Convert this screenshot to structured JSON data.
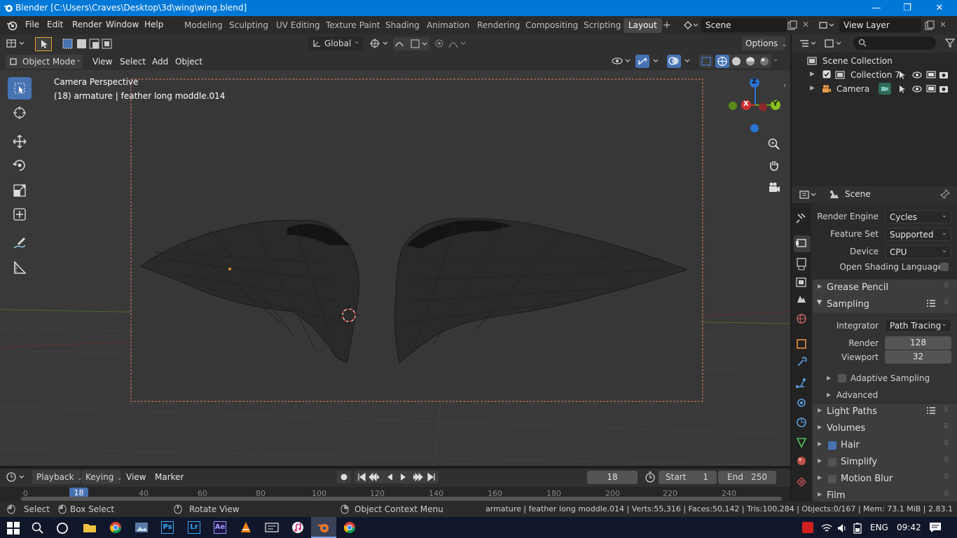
{
  "window": {
    "title": "Blender [C:\\Users\\Craves\\Desktop\\3d\\wing\\wing.blend]",
    "controls": {
      "minimize": "—",
      "maximize": "❐",
      "close": "✕"
    }
  },
  "menu": {
    "file": "File",
    "edit": "Edit",
    "render": "Render",
    "window": "Window",
    "help": "Help"
  },
  "workspaces": [
    "Modeling",
    "Sculpting",
    "UV Editing",
    "Texture Paint",
    "Shading",
    "Animation",
    "Rendering",
    "Compositing",
    "Scripting",
    "Layout"
  ],
  "active_workspace": "Layout",
  "scene_field": "Scene",
  "view_layer_field": "View Layer",
  "toolbar": {
    "orientation": "Global",
    "options": "Options"
  },
  "viewport_header": {
    "mode": "Object Mode",
    "view": "View",
    "select": "Select",
    "add": "Add",
    "object": "Object"
  },
  "viewport": {
    "camera_label": "Camera Perspective",
    "object_label": "(18) armature | feather long moddle.014",
    "gizmo": {
      "z": "Z",
      "x": "X",
      "y": "Y"
    }
  },
  "outliner": {
    "scene_collection": "Scene Collection",
    "items": [
      {
        "label": "Collection 7"
      },
      {
        "label": "Camera"
      }
    ]
  },
  "properties": {
    "header": "Scene",
    "render_engine_label": "Render Engine",
    "render_engine": "Cycles",
    "feature_set_label": "Feature Set",
    "feature_set": "Supported",
    "device_label": "Device",
    "device": "CPU",
    "osl_label": "Open Shading Language",
    "panels": {
      "grease_pencil": "Grease Pencil",
      "sampling": "Sampling",
      "integrator_label": "Integrator",
      "integrator": "Path Tracing",
      "render_label": "Render",
      "render_samples": "128",
      "viewport_label": "Viewport",
      "viewport_samples": "32",
      "adaptive_sampling": "Adaptive Sampling",
      "advanced": "Advanced",
      "light_paths": "Light Paths",
      "volumes": "Volumes",
      "hair": "Hair",
      "simplify": "Simplify",
      "motion_blur": "Motion Blur",
      "film": "Film"
    }
  },
  "timeline": {
    "playback": "Playback",
    "keying": "Keying",
    "view": "View",
    "marker": "Marker",
    "current_frame": "18",
    "start_label": "Start",
    "start": "1",
    "end_label": "End",
    "end": "250",
    "ruler": [
      "0",
      "18",
      "40",
      "60",
      "80",
      "100",
      "120",
      "140",
      "160",
      "180",
      "200",
      "220",
      "240"
    ]
  },
  "statusbar": {
    "select": "Select",
    "box_select": "Box Select",
    "rotate_view": "Rotate View",
    "context_menu": "Object Context Menu",
    "stats": "armature | feather long moddle.014 | Verts:55,316 | Faces:50,142 | Tris:100,284 | Objects:0/167 | Mem: 73.1 MiB | 2.83.1"
  },
  "taskbar": {
    "apps": [
      "Ps",
      "Lr",
      "Ae"
    ],
    "language": "ENG",
    "clock": "09:42"
  },
  "colors": {
    "accent": "#4772b3",
    "titlebar": "#0078d7"
  }
}
